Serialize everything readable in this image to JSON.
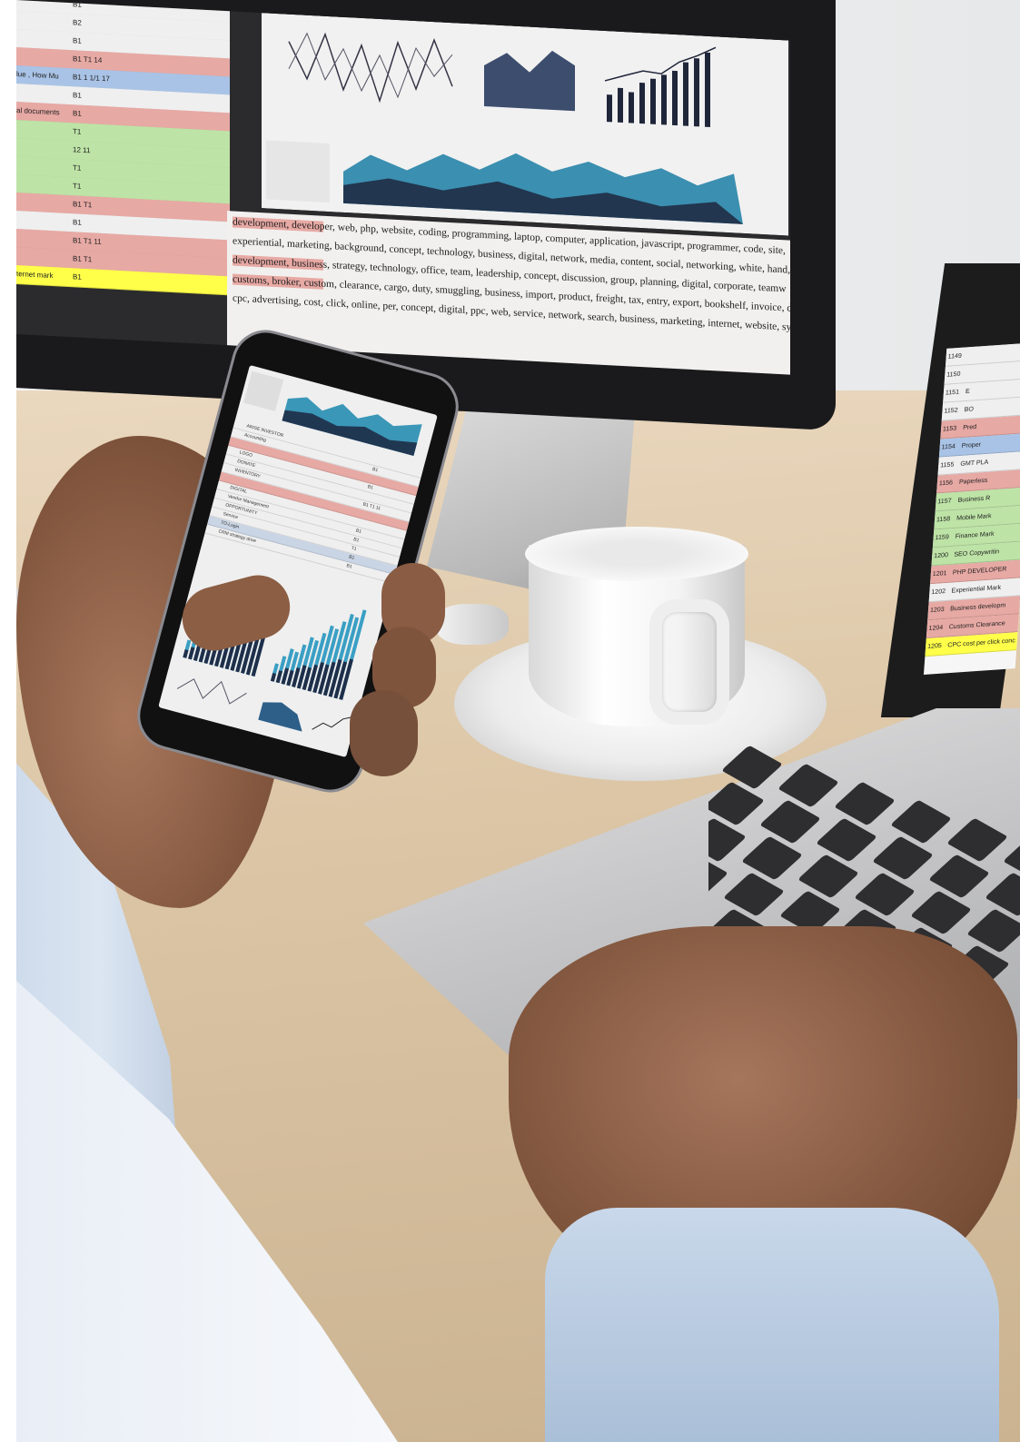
{
  "scene": {
    "monitor": {
      "sheet_rows": [
        {
          "key": "",
          "value": "B1"
        },
        {
          "key": "",
          "value": "B2"
        },
        {
          "key": "",
          "value": "B1"
        },
        {
          "key": "",
          "value": "B1 T1 14"
        },
        {
          "key": "lue , How Mu",
          "value": "B1 1 1/1 17"
        },
        {
          "key": "",
          "value": "B1"
        },
        {
          "key": "al documents",
          "value": "B1"
        },
        {
          "key": "",
          "value": "T1"
        },
        {
          "key": "",
          "value": "12 11"
        },
        {
          "key": "",
          "value": "T1"
        },
        {
          "key": "",
          "value": "T1"
        },
        {
          "key": "",
          "value": "B1 T1"
        },
        {
          "key": "",
          "value": "B1"
        },
        {
          "key": "",
          "value": "B1 T1 11"
        },
        {
          "key": "",
          "value": "B1 T1"
        },
        {
          "key": "ternet mark",
          "value": "B1"
        }
      ],
      "sheet_row_colors": [
        "#efefef",
        "#efefef",
        "#efefef",
        "#e7a9a4",
        "#a9c3e6",
        "#efefef",
        "#e7a9a4",
        "#bde3a6",
        "#bde3a6",
        "#bde3a6",
        "#bde3a6",
        "#e7a9a4",
        "#efefef",
        "#e7a9a4",
        "#e7a9a4",
        "#ffff4a"
      ],
      "keywords": [
        "development, developer, web, php, website, coding, programming, laptop, computer, application, javascript, programmer, code, site,",
        "experiential, marketing, background, concept, technology, business, digital, network, media, content, social, networking, white, hand,",
        "development, business, strategy, technology, office, team, leadership, concept, discussion, group, planning, digital, corporate, teamw",
        "customs, broker, custom, clearance, cargo, duty, smuggling, business, import, product, freight, tax, entry, export, bookshelf, invoice, d",
        "cpc, advertising, cost, click, online, per, concept, digital, ppc, web, service, network, search, business, marketing, internet, website, sy"
      ],
      "keyword_colors": [
        "#e7a9a4",
        "#f2f0ee",
        "#e7a9a4",
        "#e7a9a4",
        "#f2f0ee"
      ]
    },
    "laptop": {
      "sheet_rows": [
        {
          "num": "1149",
          "label": ""
        },
        {
          "num": "1150",
          "label": ""
        },
        {
          "num": "1151",
          "label": "E"
        },
        {
          "num": "1152",
          "label": "BO"
        },
        {
          "num": "1153",
          "label": "Pred"
        },
        {
          "num": "1154",
          "label": "Proper"
        },
        {
          "num": "1155",
          "label": "GMT PLA"
        },
        {
          "num": "1156",
          "label": "Paperless"
        },
        {
          "num": "1157",
          "label": "Business R"
        },
        {
          "num": "1158",
          "label": "Mobile Mark"
        },
        {
          "num": "1159",
          "label": "Finance Mark"
        },
        {
          "num": "1200",
          "label": "SEO Copywritin"
        },
        {
          "num": "1201",
          "label": "PHP DEVELOPER"
        },
        {
          "num": "1202",
          "label": "Experiential Mark"
        },
        {
          "num": "1203",
          "label": "Business developm"
        },
        {
          "num": "1204",
          "label": "Customs Clearance"
        },
        {
          "num": "1205",
          "label": "CPC cost per click conc"
        }
      ],
      "sheet_row_colors": [
        "#efefef",
        "#efefef",
        "#efefef",
        "#efefef",
        "#e7a9a4",
        "#a9c3e6",
        "#efefef",
        "#e7a9a4",
        "#bde3a6",
        "#bde3a6",
        "#bde3a6",
        "#bde3a6",
        "#e7a9a4",
        "#efefef",
        "#e7a9a4",
        "#e7a9a4",
        "#ffff4a"
      ]
    },
    "phone": {
      "sheet_rows": [
        {
          "label": "ARISE INVESTOR",
          "value": ""
        },
        {
          "label": "Accounting",
          "value": "B1"
        },
        {
          "label": "",
          "value": ""
        },
        {
          "label": "LOGO",
          "value": "B1"
        },
        {
          "label": "DONATE",
          "value": ""
        },
        {
          "label": "INVENTORY",
          "value": "B1 T1 11"
        },
        {
          "label": "",
          "value": ""
        },
        {
          "label": "DIGITAL",
          "value": ""
        },
        {
          "label": "Vendor Management",
          "value": "B1"
        },
        {
          "label": "OPPORTUNITY",
          "value": "B1"
        },
        {
          "label": "Service",
          "value": "T1"
        },
        {
          "label": "TO-Login",
          "value": "B1"
        },
        {
          "label": "CRM strategy drive",
          "value": "B1"
        }
      ],
      "sheet_row_colors": [
        "#efefef",
        "#efefef",
        "#e7a9a4",
        "#efefef",
        "#efefef",
        "#efefef",
        "#e7a9a4",
        "#efefef",
        "#efefef",
        "#efefef",
        "#efefef",
        "#c9d4e4",
        "#efefef"
      ]
    }
  }
}
